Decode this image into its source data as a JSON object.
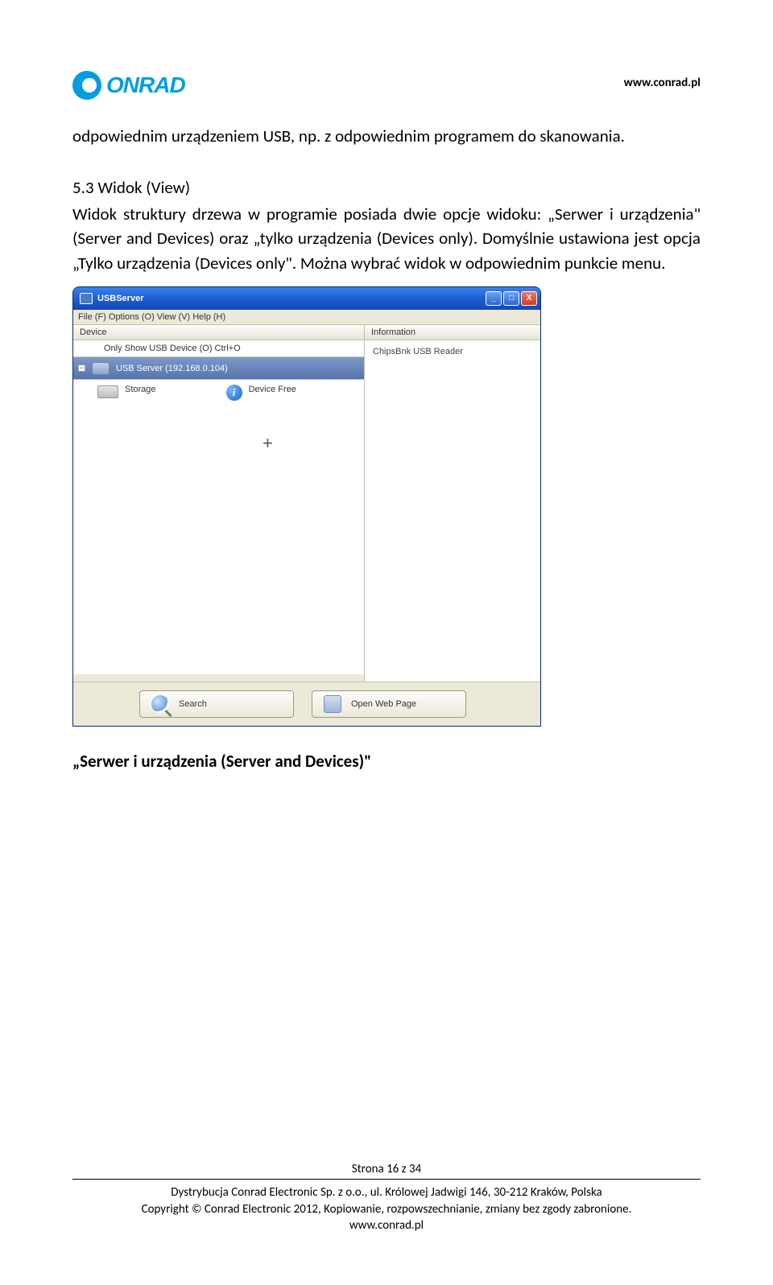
{
  "header": {
    "logo_text": "ONRAD",
    "url": "www.conrad.pl"
  },
  "content": {
    "para1": "odpowiednim urządzeniem USB, np. z odpowiednim programem do skanowania.",
    "heading": "5.3 Widok (View)",
    "para2": "Widok struktury drzewa w programie posiada dwie opcje widoku: „Serwer i urządzenia\" (Server and Devices) oraz „tylko urządzenia (Devices only). Domyślnie ustawiona jest opcja „Tylko urządzenia (Devices only\". Można wybrać widok w odpowiednim punkcie menu.",
    "sub_heading": "„Serwer i urządzenia (Server and Devices)\""
  },
  "app": {
    "title": "USBServer",
    "menubar": "File (F)   Options (O)   View (V)   Help (H)",
    "submenu": "Only Show USB Device  (O)   Ctrl+O",
    "left_header": "Device",
    "right_header": "Information",
    "server_row": "USB Server (192.168.0.104)",
    "storage_label": "Storage",
    "status_label": "Device Free",
    "info_label": "ChipsBnk USB Reader",
    "buttons": {
      "search": "Search",
      "open_web": "Open Web Page"
    },
    "win_btns": {
      "min": "_",
      "max": "□",
      "close": "X"
    }
  },
  "footer": {
    "pager": "Strona 16 z 34",
    "line1": "Dystrybucja Conrad Electronic Sp. z o.o., ul. Królowej Jadwigi 146, 30-212 Kraków, Polska",
    "line2": "Copyright © Conrad Electronic 2012, Kopiowanie, rozpowszechnianie, zmiany bez zgody zabronione.",
    "line3": "www.conrad.pl"
  }
}
